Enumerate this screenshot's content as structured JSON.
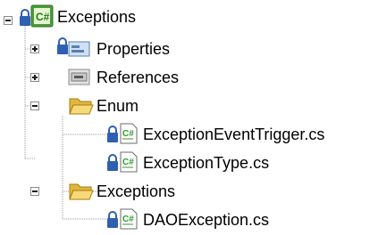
{
  "tree": {
    "root": {
      "label": "Exceptions",
      "expanded": true,
      "icon": "csharp-project-icon"
    },
    "items": [
      {
        "label": "Properties",
        "icon": "properties-folder-icon",
        "expanded": false
      },
      {
        "label": "References",
        "icon": "references-folder-icon",
        "expanded": false
      },
      {
        "label": "Enum",
        "icon": "folder-open-icon",
        "expanded": true,
        "children": [
          {
            "label": "ExceptionEventTrigger.cs",
            "icon": "csharp-file-icon"
          },
          {
            "label": "ExceptionType.cs",
            "icon": "csharp-file-icon"
          }
        ]
      },
      {
        "label": "Exceptions",
        "icon": "folder-open-icon",
        "expanded": true,
        "children": [
          {
            "label": "DAOException.cs",
            "icon": "csharp-file-icon"
          }
        ]
      }
    ]
  },
  "colors": {
    "tree_line": "#9a9a9a",
    "lock": "#2f5fb0",
    "csharp_green": "#2e9b2e",
    "folder": "#f2c94c"
  }
}
